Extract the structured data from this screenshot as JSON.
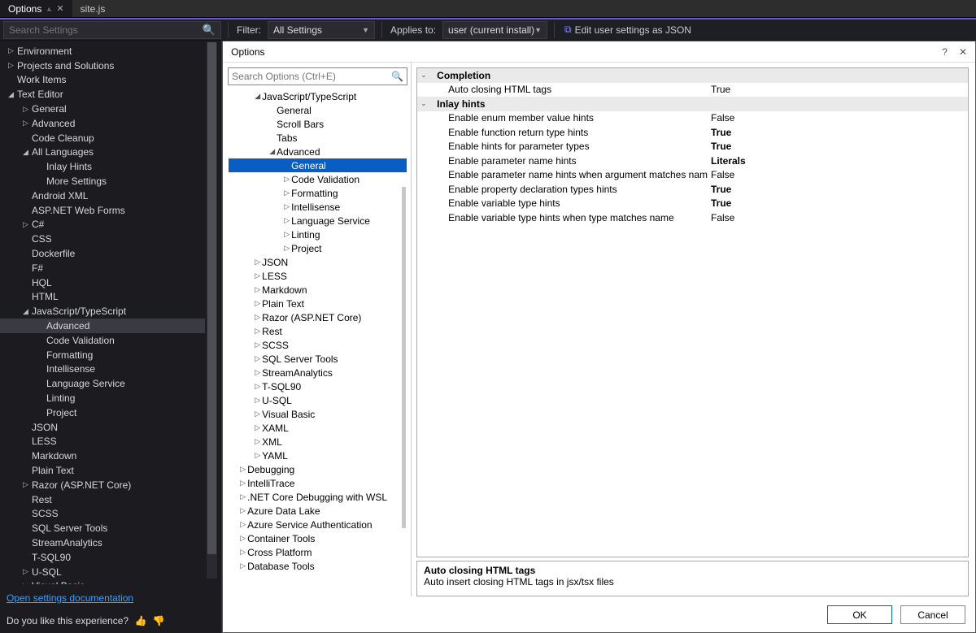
{
  "tabs": [
    {
      "label": "Options",
      "active": true,
      "pinned": true
    },
    {
      "label": "site.js",
      "active": false
    }
  ],
  "toolbar": {
    "search_placeholder": "Search Settings",
    "filter_label": "Filter:",
    "filter_value": "All Settings",
    "applies_label": "Applies to:",
    "applies_value": "user (current install)",
    "json_link": "Edit user settings as JSON"
  },
  "sidebar_tree": [
    {
      "d": 0,
      "tw": "▷",
      "t": "Environment"
    },
    {
      "d": 0,
      "tw": "▷",
      "t": "Projects and Solutions"
    },
    {
      "d": 0,
      "tw": "",
      "t": "Work Items"
    },
    {
      "d": 0,
      "tw": "◢",
      "t": "Text Editor"
    },
    {
      "d": 1,
      "tw": "▷",
      "t": "General"
    },
    {
      "d": 1,
      "tw": "▷",
      "t": "Advanced"
    },
    {
      "d": 1,
      "tw": "",
      "t": "Code Cleanup"
    },
    {
      "d": 1,
      "tw": "◢",
      "t": "All Languages"
    },
    {
      "d": 2,
      "tw": "",
      "t": "Inlay Hints"
    },
    {
      "d": 2,
      "tw": "",
      "t": "More Settings"
    },
    {
      "d": 1,
      "tw": "",
      "t": "Android XML"
    },
    {
      "d": 1,
      "tw": "",
      "t": "ASP.NET Web Forms"
    },
    {
      "d": 1,
      "tw": "▷",
      "t": "C#"
    },
    {
      "d": 1,
      "tw": "",
      "t": "CSS"
    },
    {
      "d": 1,
      "tw": "",
      "t": "Dockerfile"
    },
    {
      "d": 1,
      "tw": "",
      "t": "F#"
    },
    {
      "d": 1,
      "tw": "",
      "t": "HQL"
    },
    {
      "d": 1,
      "tw": "",
      "t": "HTML"
    },
    {
      "d": 1,
      "tw": "◢",
      "t": "JavaScript/TypeScript"
    },
    {
      "d": 2,
      "tw": "",
      "t": "Advanced",
      "sel": true
    },
    {
      "d": 2,
      "tw": "",
      "t": "Code Validation"
    },
    {
      "d": 2,
      "tw": "",
      "t": "Formatting"
    },
    {
      "d": 2,
      "tw": "",
      "t": "Intellisense"
    },
    {
      "d": 2,
      "tw": "",
      "t": "Language Service"
    },
    {
      "d": 2,
      "tw": "",
      "t": "Linting"
    },
    {
      "d": 2,
      "tw": "",
      "t": "Project"
    },
    {
      "d": 1,
      "tw": "",
      "t": "JSON"
    },
    {
      "d": 1,
      "tw": "",
      "t": "LESS"
    },
    {
      "d": 1,
      "tw": "",
      "t": "Markdown"
    },
    {
      "d": 1,
      "tw": "",
      "t": "Plain Text"
    },
    {
      "d": 1,
      "tw": "▷",
      "t": "Razor (ASP.NET Core)"
    },
    {
      "d": 1,
      "tw": "",
      "t": "Rest"
    },
    {
      "d": 1,
      "tw": "",
      "t": "SCSS"
    },
    {
      "d": 1,
      "tw": "",
      "t": "SQL Server Tools"
    },
    {
      "d": 1,
      "tw": "",
      "t": "StreamAnalytics"
    },
    {
      "d": 1,
      "tw": "",
      "t": "T-SQL90"
    },
    {
      "d": 1,
      "tw": "▷",
      "t": "U-SQL"
    },
    {
      "d": 1,
      "tw": "▷",
      "t": "Visual Basic"
    }
  ],
  "sidebar_footer": {
    "doc_link": "Open settings documentation",
    "feedback_q": "Do you like this experience?"
  },
  "dialog": {
    "title": "Options",
    "help": "?",
    "close": "✕",
    "search_placeholder": "Search Options (Ctrl+E)",
    "tree": [
      {
        "d": 0,
        "tw": "◢",
        "t": "JavaScript/TypeScript"
      },
      {
        "d": 1,
        "tw": "",
        "t": "General"
      },
      {
        "d": 1,
        "tw": "",
        "t": "Scroll Bars"
      },
      {
        "d": 1,
        "tw": "",
        "t": "Tabs"
      },
      {
        "d": 1,
        "tw": "◢",
        "t": "Advanced"
      },
      {
        "d": 2,
        "tw": "",
        "t": "General",
        "sel": true
      },
      {
        "d": 2,
        "tw": "▷",
        "t": "Code Validation"
      },
      {
        "d": 2,
        "tw": "▷",
        "t": "Formatting"
      },
      {
        "d": 2,
        "tw": "▷",
        "t": "Intellisense"
      },
      {
        "d": 2,
        "tw": "▷",
        "t": "Language Service"
      },
      {
        "d": 2,
        "tw": "▷",
        "t": "Linting"
      },
      {
        "d": 2,
        "tw": "▷",
        "t": "Project"
      },
      {
        "d": 0,
        "tw": "▷",
        "t": "JSON"
      },
      {
        "d": 0,
        "tw": "▷",
        "t": "LESS"
      },
      {
        "d": 0,
        "tw": "▷",
        "t": "Markdown"
      },
      {
        "d": 0,
        "tw": "▷",
        "t": "Plain Text"
      },
      {
        "d": 0,
        "tw": "▷",
        "t": "Razor (ASP.NET Core)"
      },
      {
        "d": 0,
        "tw": "▷",
        "t": "Rest"
      },
      {
        "d": 0,
        "tw": "▷",
        "t": "SCSS"
      },
      {
        "d": 0,
        "tw": "▷",
        "t": "SQL Server Tools"
      },
      {
        "d": 0,
        "tw": "▷",
        "t": "StreamAnalytics"
      },
      {
        "d": 0,
        "tw": "▷",
        "t": "T-SQL90"
      },
      {
        "d": 0,
        "tw": "▷",
        "t": "U-SQL"
      },
      {
        "d": 0,
        "tw": "▷",
        "t": "Visual Basic"
      },
      {
        "d": 0,
        "tw": "▷",
        "t": "XAML"
      },
      {
        "d": 0,
        "tw": "▷",
        "t": "XML"
      },
      {
        "d": 0,
        "tw": "▷",
        "t": "YAML"
      },
      {
        "d": -1,
        "tw": "▷",
        "t": "Debugging"
      },
      {
        "d": -1,
        "tw": "▷",
        "t": "IntelliTrace"
      },
      {
        "d": -1,
        "tw": "▷",
        "t": ".NET Core Debugging with WSL"
      },
      {
        "d": -1,
        "tw": "▷",
        "t": "Azure Data Lake"
      },
      {
        "d": -1,
        "tw": "▷",
        "t": "Azure Service Authentication"
      },
      {
        "d": -1,
        "tw": "▷",
        "t": "Container Tools"
      },
      {
        "d": -1,
        "tw": "▷",
        "t": "Cross Platform"
      },
      {
        "d": -1,
        "tw": "▷",
        "t": "Database Tools"
      }
    ],
    "grid": {
      "cats": [
        {
          "name": "Completion",
          "props": [
            {
              "n": "Auto closing HTML tags",
              "v": "True",
              "b": false
            }
          ]
        },
        {
          "name": "Inlay hints",
          "props": [
            {
              "n": "Enable enum member value hints",
              "v": "False",
              "b": false
            },
            {
              "n": "Enable function return type hints",
              "v": "True",
              "b": true
            },
            {
              "n": "Enable hints for parameter types",
              "v": "True",
              "b": true
            },
            {
              "n": "Enable parameter name hints",
              "v": "Literals",
              "b": true
            },
            {
              "n": "Enable parameter name hints when argument matches nam",
              "v": "False",
              "b": false
            },
            {
              "n": "Enable property declaration types hints",
              "v": "True",
              "b": true
            },
            {
              "n": "Enable variable type hints",
              "v": "True",
              "b": true
            },
            {
              "n": "Enable variable type hints when type matches name",
              "v": "False",
              "b": false
            }
          ]
        }
      ]
    },
    "desc": {
      "title": "Auto closing HTML tags",
      "text": "Auto insert closing HTML tags in jsx/tsx files"
    },
    "ok": "OK",
    "cancel": "Cancel"
  }
}
